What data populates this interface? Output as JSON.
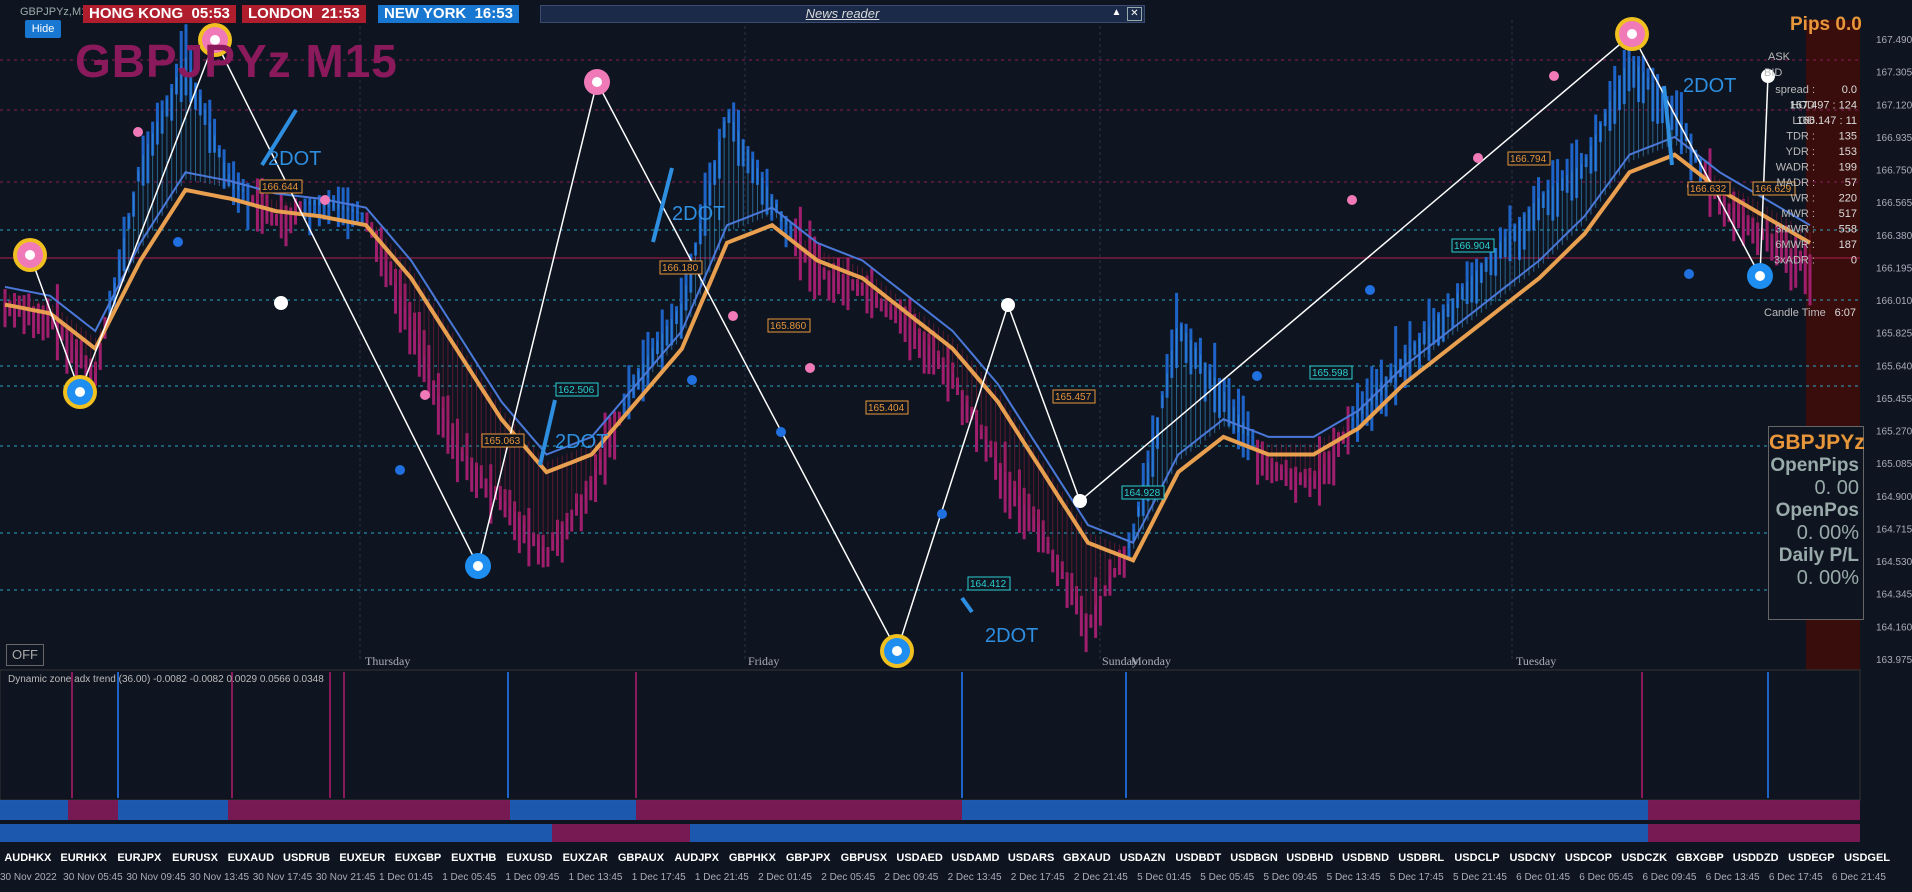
{
  "window": {
    "symbol_small": "GBPJPYz,M15",
    "hide_label": "Hide",
    "off_label": "OFF"
  },
  "clocks": [
    {
      "label": "HONG KONG",
      "time": "05:53",
      "color": "#b01e2e"
    },
    {
      "label": "LONDON",
      "time": "21:53",
      "color": "#b01e2e"
    },
    {
      "label": "NEW YORK",
      "time": "16:53",
      "color": "#1877d0"
    }
  ],
  "news": {
    "label": "News reader"
  },
  "title": "GBPJPYz M15",
  "pips": "Pips 0.0",
  "days": [
    "Thursday",
    "Friday",
    "Sunday",
    "Monday",
    "Tuesday"
  ],
  "info": {
    "ask_label": "ASK",
    "bid_label": "BID",
    "rows": [
      {
        "k": "spread :",
        "v": "0.0"
      },
      {
        "k": "HOD",
        "v": "167.497 :",
        "v2": "124"
      },
      {
        "k": "LOD",
        "v": "166.147 :",
        "v2": "11"
      },
      {
        "k": "TDR :",
        "v": "135"
      },
      {
        "k": "YDR :",
        "v": "153"
      },
      {
        "k": "WADR :",
        "v": "199"
      },
      {
        "k": "MADR :",
        "v": "57"
      },
      {
        "k": "WR :",
        "v": "220"
      },
      {
        "k": "MWR :",
        "v": "517"
      },
      {
        "k": "3MWR :",
        "v": "558"
      },
      {
        "k": "6MWR :",
        "v": "187"
      },
      {
        "k": "3xADR :",
        "v": "0"
      }
    ],
    "candle_time": "Candle Time",
    "candle_val": "6:07"
  },
  "panel": {
    "symbol": "GBPJPYz",
    "open_pips_label": "OpenPips",
    "open_pips": "0. 00",
    "open_pos_label": "OpenPos",
    "open_pos": "0. 00%",
    "daily_label": "Daily P/L",
    "daily": "0. 00%"
  },
  "indicator_title": "Dynamic zone  adx trend (36.00) -0.0082 -0.0082 0.0029 0.0566 0.0348",
  "dot_labels": [
    "2DOT",
    "2DOT",
    "2DOT",
    "2DOT",
    "2DOT"
  ],
  "level_labels": [
    "166.644",
    "162.506",
    "165.063",
    "166.180",
    "165.860",
    "165.404",
    "164.412",
    "165.457",
    "164.928",
    "165.598",
    "166.904",
    "166.794",
    "166.632",
    "166.629"
  ],
  "symbols": [
    "AUDHKX",
    "EURHKX",
    "EURJPX",
    "EURUSX",
    "EUXAUD",
    "USDRUB",
    "EUXEUR",
    "EUXGBP",
    "EUXTHB",
    "EUXUSD",
    "EUXZAR",
    "GBPAUX",
    "AUDJPX",
    "GBPHKX",
    "GBPJPX",
    "GBPUSX",
    "USDAED",
    "USDAMD",
    "USDARS",
    "GBXAUD",
    "USDAZN",
    "USDBDT",
    "USDBGN",
    "USDBHD",
    "USDBND",
    "USDBRL",
    "USDCLP",
    "USDCNY",
    "USDCOP",
    "USDCZK",
    "GBXGBP",
    "USDDZD",
    "USDEGP",
    "USDGEL"
  ],
  "times": [
    "30 Nov 2022",
    "30 Nov 05:45",
    "30 Nov 09:45",
    "30 Nov 13:45",
    "30 Nov 17:45",
    "30 Nov 21:45",
    "1 Dec 01:45",
    "1 Dec 05:45",
    "1 Dec 09:45",
    "1 Dec 13:45",
    "1 Dec 17:45",
    "1 Dec 21:45",
    "2 Dec 01:45",
    "2 Dec 05:45",
    "2 Dec 09:45",
    "2 Dec 13:45",
    "2 Dec 17:45",
    "2 Dec 21:45",
    "5 Dec 01:45",
    "5 Dec 05:45",
    "5 Dec 09:45",
    "5 Dec 13:45",
    "5 Dec 17:45",
    "5 Dec 21:45",
    "6 Dec 01:45",
    "6 Dec 05:45",
    "6 Dec 09:45",
    "6 Dec 13:45",
    "6 Dec 17:45",
    "6 Dec 21:45"
  ],
  "chart_data": {
    "type": "line",
    "title": "GBPJPYz M15",
    "ylim": [
      163.975,
      167.49
    ],
    "y_ticks": [
      "167.490",
      "167.305",
      "167.120",
      "166.935",
      "166.750",
      "166.565",
      "166.380",
      "166.195",
      "166.010",
      "165.825",
      "165.640",
      "165.455",
      "165.270",
      "165.085",
      "164.900",
      "164.715",
      "164.530",
      "164.345",
      "164.160",
      "163.975"
    ],
    "series": [
      {
        "values": [
          166.0,
          165.95,
          165.6,
          166.8,
          167.4,
          166.7,
          166.5,
          166.6,
          166.5,
          165.9,
          165.2,
          164.9,
          164.6,
          165.0,
          165.6,
          166.0,
          167.1,
          166.6,
          166.2,
          166.1,
          165.9,
          165.6,
          165.1,
          164.7,
          164.2,
          164.7,
          165.9,
          165.5,
          165.1,
          165.0,
          165.4,
          165.7,
          166.0,
          166.3,
          166.6,
          166.8,
          167.4,
          167.1,
          166.6,
          166.4,
          166.2
        ]
      },
      {
        "values": [
          166.05,
          166.0,
          165.8,
          166.3,
          166.7,
          166.65,
          166.58,
          166.55,
          166.5,
          166.2,
          165.8,
          165.4,
          165.1,
          165.2,
          165.5,
          165.8,
          166.4,
          166.5,
          166.3,
          166.2,
          166.0,
          165.8,
          165.5,
          165.1,
          164.7,
          164.6,
          165.1,
          165.3,
          165.2,
          165.2,
          165.35,
          165.6,
          165.8,
          166.0,
          166.2,
          166.45,
          166.8,
          166.9,
          166.7,
          166.55,
          166.4
        ]
      }
    ]
  }
}
